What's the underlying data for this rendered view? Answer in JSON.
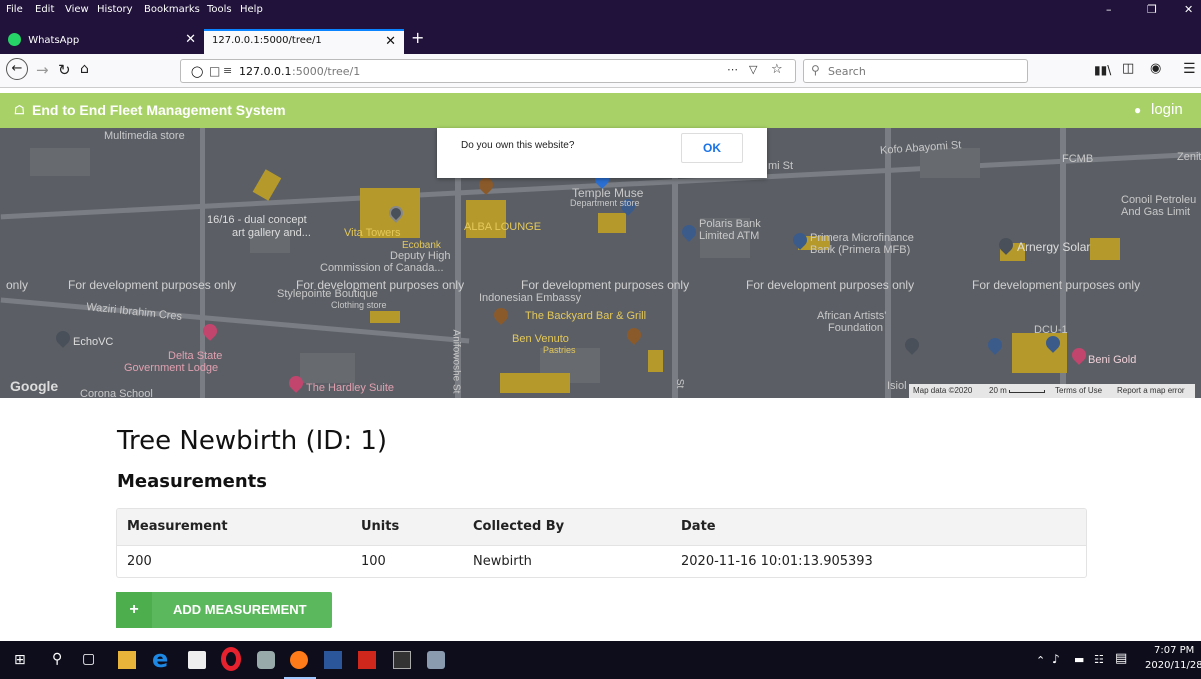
{
  "menubar": {
    "items": [
      "File",
      "Edit",
      "View",
      "History",
      "Bookmarks",
      "Tools",
      "Help"
    ]
  },
  "tabs": [
    {
      "title": "WhatsApp"
    },
    {
      "title": "127.0.0.1:5000/tree/1"
    }
  ],
  "address": {
    "host": "127.0.0.1",
    "path": ":5000/tree/1"
  },
  "search": {
    "placeholder": "Search"
  },
  "app": {
    "brand": "End to End Fleet Management System",
    "login": "login"
  },
  "map": {
    "dialog_text": "Do you own this website?",
    "dialog_button": "OK",
    "watermark": "For development purposes only",
    "watermark_cut": "only",
    "labels": {
      "multimedia": "Multimedia store",
      "gallery1": "16/16 - dual concept",
      "gallery2": "art gallery and...",
      "vita": "Vita Towers",
      "ecobank": "Ecobank",
      "deputy1": "Deputy High",
      "deputy2": "Commission of Canada...",
      "stylepointe": "Stylepointe Boutique",
      "clothing": "Clothing store",
      "alba": "ALBA LOUNGE",
      "temple": "Temple Muse",
      "dept": "Department store",
      "polaris1": "Polaris Bank",
      "polaris2": "Limited ATM",
      "primera1": "Primera Microfinance",
      "primera2": "Bank (Primera MFB)",
      "arnergy": "Arnergy Solar",
      "fcmb": "FCMB",
      "conoil1": "Conoil Petroleu",
      "conoil2": "And Gas Limit",
      "zenith": "Zenit",
      "kofo": "Kofo Abayomi St",
      "mist": "mi St",
      "indonesian": "Indonesian Embassy",
      "backyard": "The Backyard Bar & Grill",
      "benvenuto": "Ben Venuto",
      "pastries": "Pastries",
      "african1": "African Artists'",
      "african2": "Foundation",
      "dcu": "DCU-1",
      "benigold": "Beni Gold",
      "waziri": "Waziri Ibrahim Cres",
      "echovc": "EchoVC",
      "delta1": "Delta State",
      "delta2": "Government Lodge",
      "hardley": "The Hardley Suite",
      "corona": "Corona School",
      "anifowoshe": "Anifowoshe St",
      "isiola": "Isiol",
      "st": "St",
      "google": "Google"
    },
    "footer": {
      "data": "Map data ©2020",
      "scale": "20 m",
      "terms": "Terms of Use",
      "report": "Report a map error"
    }
  },
  "page": {
    "title": "Tree Newbirth (ID: 1)",
    "subtitle": "Measurements",
    "table": {
      "headers": [
        "Measurement",
        "Units",
        "Collected By",
        "Date"
      ],
      "rows": [
        [
          "200",
          "100",
          "Newbirth",
          "2020-11-16 10:01:13.905393"
        ]
      ]
    },
    "add_button": "ADD MEASUREMENT"
  },
  "taskbar": {
    "time": "7:07 PM",
    "date": "2020/11/28"
  },
  "colors": {
    "accent_green": "#a8d267",
    "button_green": "#5cb85c",
    "browser_dark": "#20123a",
    "tab_blue": "#0a84ff"
  }
}
